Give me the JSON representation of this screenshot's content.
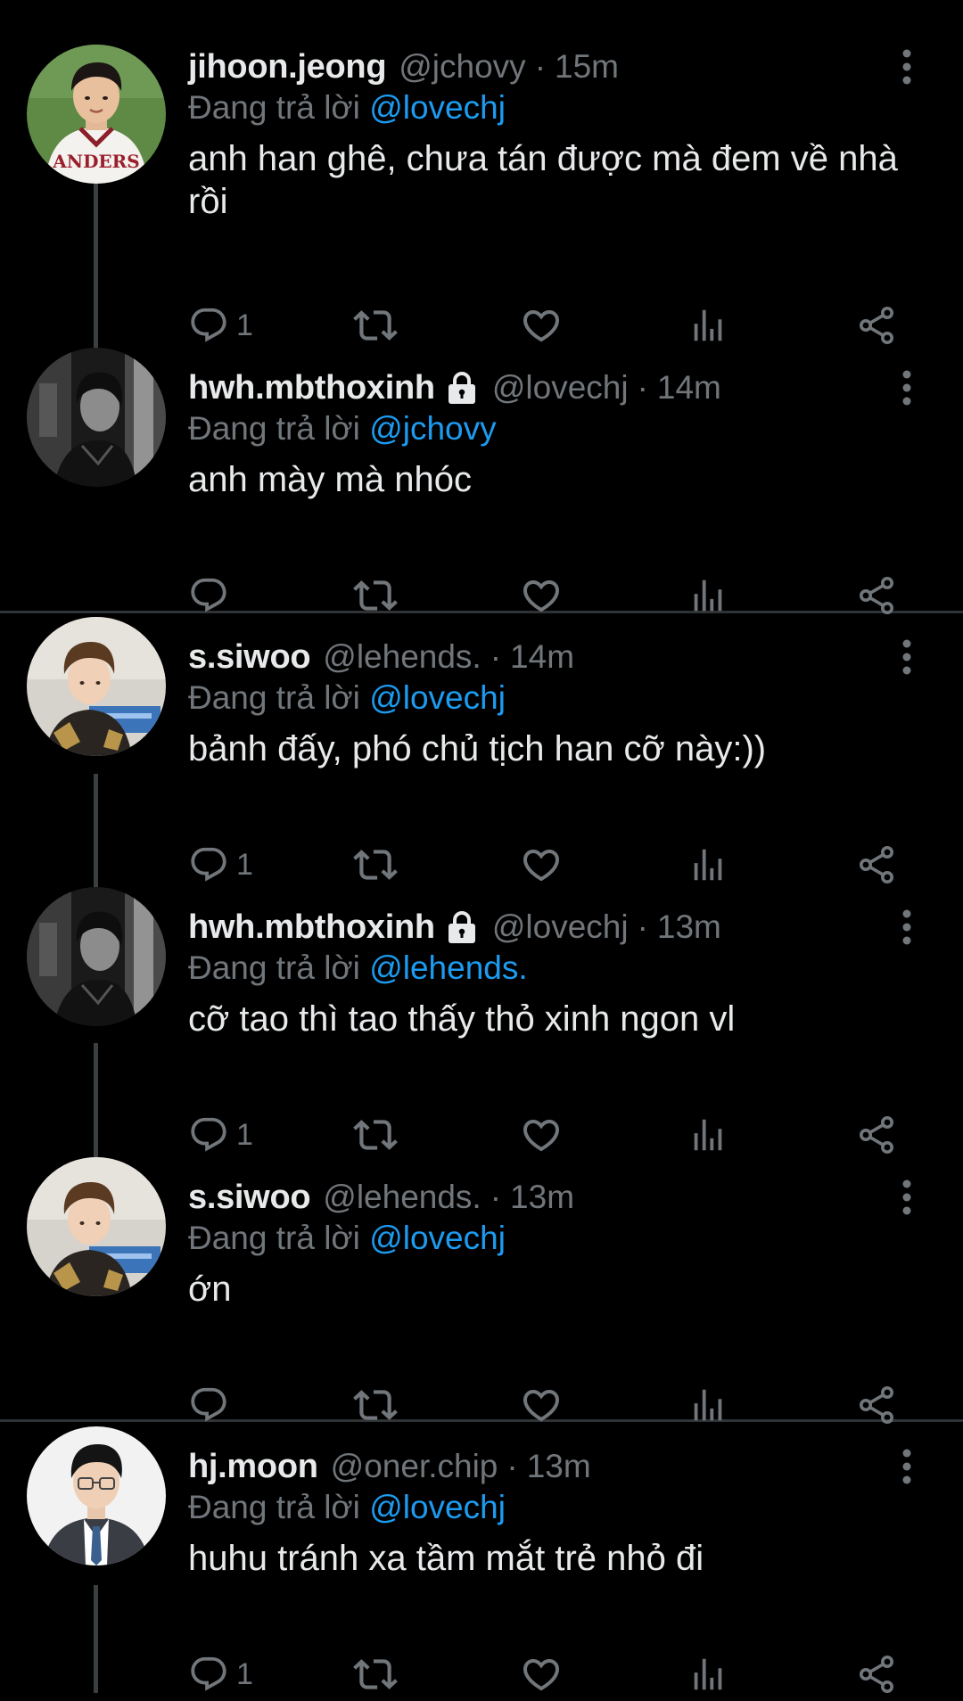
{
  "theme": {
    "background": "#000000",
    "text": "#e7e9ea",
    "secondary_text": "#71767b",
    "mention_color": "#1d9bf0",
    "thread_line": "#3a3f44",
    "divider": "#2f3336"
  },
  "reply_prefix": "Đang trả lời",
  "separator": "·",
  "tweets": [
    {
      "display_name": "jihoon.jeong",
      "handle": "@jchovy",
      "time": "15m",
      "locked": false,
      "replying_to": "@lovechj",
      "text": "anh han ghê, chưa tán được mà đem về nhà rồi",
      "reply_count": "1",
      "avatar_icon": "avatar-jersey-photo"
    },
    {
      "display_name": "hwh.mbthoxinh",
      "handle": "@lovechj",
      "time": "14m",
      "locked": true,
      "replying_to": "@jchovy",
      "text": "anh mày mà nhóc",
      "reply_count": "",
      "avatar_icon": "avatar-dark-photo"
    },
    {
      "display_name": "s.siwoo",
      "handle": "@lehends.",
      "time": "14m",
      "locked": false,
      "replying_to": "@lovechj",
      "text": "bảnh đấy, phó chủ tịch han cỡ này:))",
      "reply_count": "1",
      "avatar_icon": "avatar-stage-photo"
    },
    {
      "display_name": "hwh.mbthoxinh",
      "handle": "@lovechj",
      "time": "13m",
      "locked": true,
      "replying_to": "@lehends.",
      "text": "cỡ tao thì tao thấy thỏ xinh ngon vl",
      "reply_count": "1",
      "avatar_icon": "avatar-dark-photo"
    },
    {
      "display_name": "s.siwoo",
      "handle": "@lehends.",
      "time": "13m",
      "locked": false,
      "replying_to": "@lovechj",
      "text": "ớn",
      "reply_count": "",
      "avatar_icon": "avatar-stage-photo"
    },
    {
      "display_name": "hj.moon",
      "handle": "@oner.chip",
      "time": "13m",
      "locked": false,
      "replying_to": "@lovechj",
      "text": "huhu tránh xa tầm mắt trẻ nhỏ đi",
      "reply_count": "1",
      "avatar_icon": "avatar-suit-photo"
    }
  ],
  "action_icons": [
    "reply-icon",
    "retweet-icon",
    "like-icon",
    "views-icon",
    "share-icon"
  ]
}
